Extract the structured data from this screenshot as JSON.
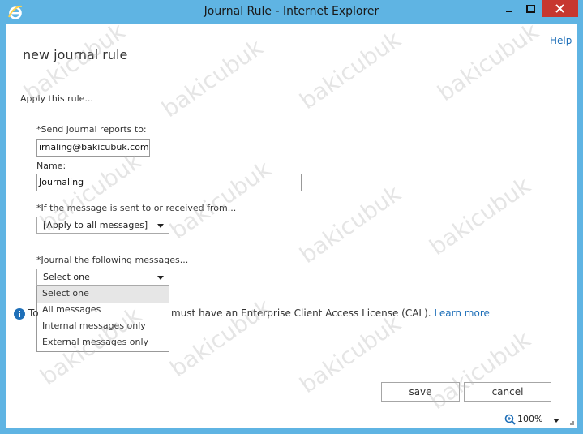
{
  "window": {
    "title": "Journal Rule - Internet Explorer",
    "accent_color": "#5fb4e3",
    "close_color": "#c7372f"
  },
  "header": {
    "help": "Help",
    "page_title": "new journal rule"
  },
  "form": {
    "apply_text": "Apply this rule...",
    "send_reports_label": "*Send journal reports to:",
    "send_reports_value": "ırnaling@bakicubuk.com",
    "name_label": "Name:",
    "name_value": "Journaling",
    "condition_label": "*If the message is sent to or received from...",
    "condition_value": "[Apply to all messages]",
    "journal_label": "*Journal the following messages...",
    "journal_value": "Select one",
    "journal_options": [
      "Select one",
      "All messages",
      "Internal messages only",
      "External messages only"
    ]
  },
  "info": {
    "prefix": "To",
    "text": "must have an Enterprise Client Access License (CAL).",
    "link": "Learn more"
  },
  "buttons": {
    "save": "save",
    "cancel": "cancel"
  },
  "status": {
    "zoom": "100%"
  },
  "watermark": "bakicubuk"
}
